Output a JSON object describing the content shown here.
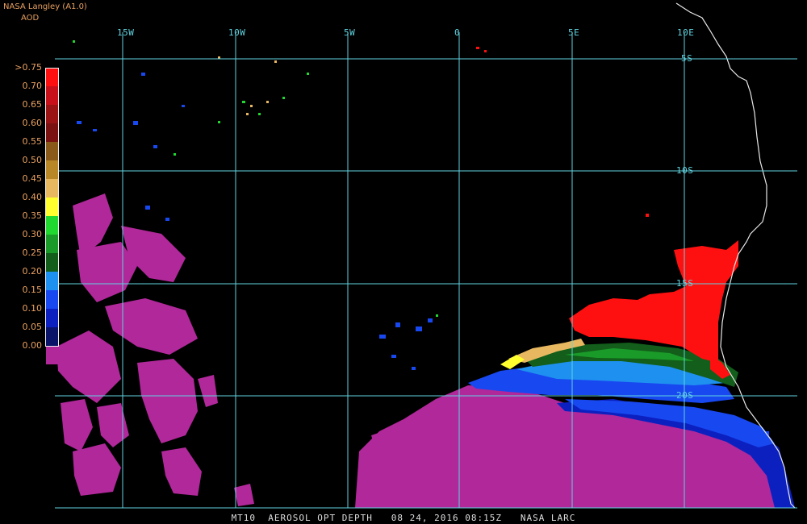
{
  "header": {
    "source": "NASA Langley (A1.0)",
    "product": "AOD"
  },
  "legend": {
    "labels": [
      ">0.75",
      "0.70",
      "0.65",
      "0.60",
      "0.55",
      "0.50",
      "0.45",
      "0.40",
      "0.35",
      "0.30",
      "0.25",
      "0.20",
      "0.15",
      "0.10",
      "0.05",
      "0.00"
    ],
    "colors": [
      "#ff1010",
      "#c8101a",
      "#9a1416",
      "#7a1212",
      "#8a5a1a",
      "#b88828",
      "#e8b860",
      "#ffff30",
      "#20d830",
      "#1a9a28",
      "#125e1a",
      "#1e90f0",
      "#1848f0",
      "#0c20c0",
      "#0a1468",
      "#b0289a"
    ]
  },
  "grid": {
    "lon_labels": [
      "15W",
      "10W",
      "5W",
      "0",
      "5E",
      "10E"
    ],
    "lat_labels": [
      "5S",
      "10S",
      "15S",
      "20S"
    ],
    "line_color": "#5fd3e0"
  },
  "footer": {
    "text": "MT10  AEROSOL OPT DEPTH   08 24, 2016 08:15Z   NASA LARC"
  }
}
